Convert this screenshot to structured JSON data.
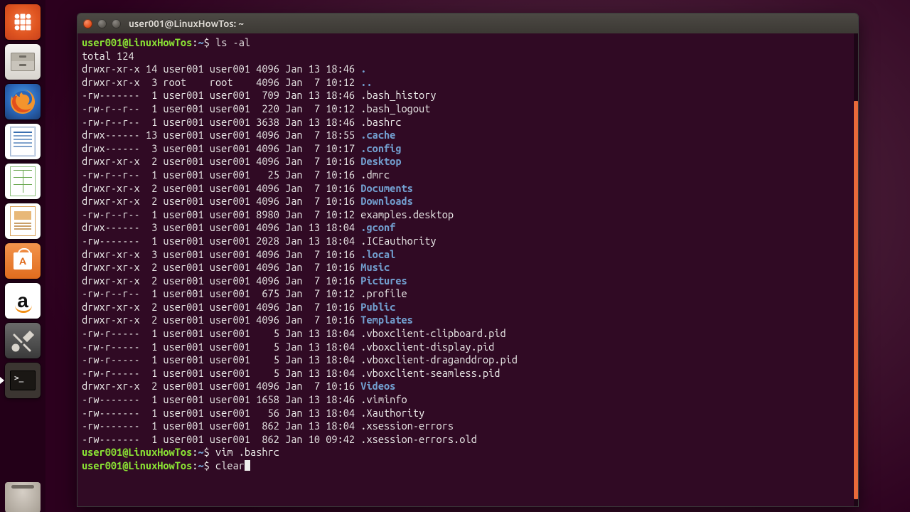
{
  "window": {
    "title": "user001@LinuxHowTos: ~"
  },
  "launcher": {
    "items": [
      "dash",
      "files",
      "firefox",
      "writer",
      "calc",
      "impress",
      "software",
      "amazon",
      "settings",
      "terminal"
    ],
    "amazon_glyph": "a"
  },
  "prompt": {
    "user": "user001",
    "host": "LinuxHowTos",
    "path": "~",
    "symbol": "$"
  },
  "commands": {
    "first": "ls -al",
    "second": "vim .bashrc",
    "third": "clear"
  },
  "total_line": "total 124",
  "listing": [
    {
      "perm": "drwxr-xr-x",
      "n": "14",
      "own": "user001",
      "grp": "user001",
      "size": "4096",
      "date": "Jan 13 18:46",
      "name": ".",
      "dir": true
    },
    {
      "perm": "drwxr-xr-x",
      "n": " 3",
      "own": "root   ",
      "grp": "root   ",
      "size": "4096",
      "date": "Jan  7 10:12",
      "name": "..",
      "dir": true
    },
    {
      "perm": "-rw-------",
      "n": " 1",
      "own": "user001",
      "grp": "user001",
      "size": " 709",
      "date": "Jan 13 18:46",
      "name": ".bash_history",
      "dir": false
    },
    {
      "perm": "-rw-r--r--",
      "n": " 1",
      "own": "user001",
      "grp": "user001",
      "size": " 220",
      "date": "Jan  7 10:12",
      "name": ".bash_logout",
      "dir": false
    },
    {
      "perm": "-rw-r--r--",
      "n": " 1",
      "own": "user001",
      "grp": "user001",
      "size": "3638",
      "date": "Jan 13 18:46",
      "name": ".bashrc",
      "dir": false
    },
    {
      "perm": "drwx------",
      "n": "13",
      "own": "user001",
      "grp": "user001",
      "size": "4096",
      "date": "Jan  7 18:55",
      "name": ".cache",
      "dir": true
    },
    {
      "perm": "drwx------",
      "n": " 3",
      "own": "user001",
      "grp": "user001",
      "size": "4096",
      "date": "Jan  7 10:17",
      "name": ".config",
      "dir": true
    },
    {
      "perm": "drwxr-xr-x",
      "n": " 2",
      "own": "user001",
      "grp": "user001",
      "size": "4096",
      "date": "Jan  7 10:16",
      "name": "Desktop",
      "dir": true
    },
    {
      "perm": "-rw-r--r--",
      "n": " 1",
      "own": "user001",
      "grp": "user001",
      "size": "  25",
      "date": "Jan  7 10:16",
      "name": ".dmrc",
      "dir": false
    },
    {
      "perm": "drwxr-xr-x",
      "n": " 2",
      "own": "user001",
      "grp": "user001",
      "size": "4096",
      "date": "Jan  7 10:16",
      "name": "Documents",
      "dir": true
    },
    {
      "perm": "drwxr-xr-x",
      "n": " 2",
      "own": "user001",
      "grp": "user001",
      "size": "4096",
      "date": "Jan  7 10:16",
      "name": "Downloads",
      "dir": true
    },
    {
      "perm": "-rw-r--r--",
      "n": " 1",
      "own": "user001",
      "grp": "user001",
      "size": "8980",
      "date": "Jan  7 10:12",
      "name": "examples.desktop",
      "dir": false
    },
    {
      "perm": "drwx------",
      "n": " 3",
      "own": "user001",
      "grp": "user001",
      "size": "4096",
      "date": "Jan 13 18:04",
      "name": ".gconf",
      "dir": true
    },
    {
      "perm": "-rw-------",
      "n": " 1",
      "own": "user001",
      "grp": "user001",
      "size": "2028",
      "date": "Jan 13 18:04",
      "name": ".ICEauthority",
      "dir": false
    },
    {
      "perm": "drwxr-xr-x",
      "n": " 3",
      "own": "user001",
      "grp": "user001",
      "size": "4096",
      "date": "Jan  7 10:16",
      "name": ".local",
      "dir": true
    },
    {
      "perm": "drwxr-xr-x",
      "n": " 2",
      "own": "user001",
      "grp": "user001",
      "size": "4096",
      "date": "Jan  7 10:16",
      "name": "Music",
      "dir": true
    },
    {
      "perm": "drwxr-xr-x",
      "n": " 2",
      "own": "user001",
      "grp": "user001",
      "size": "4096",
      "date": "Jan  7 10:16",
      "name": "Pictures",
      "dir": true
    },
    {
      "perm": "-rw-r--r--",
      "n": " 1",
      "own": "user001",
      "grp": "user001",
      "size": " 675",
      "date": "Jan  7 10:12",
      "name": ".profile",
      "dir": false
    },
    {
      "perm": "drwxr-xr-x",
      "n": " 2",
      "own": "user001",
      "grp": "user001",
      "size": "4096",
      "date": "Jan  7 10:16",
      "name": "Public",
      "dir": true
    },
    {
      "perm": "drwxr-xr-x",
      "n": " 2",
      "own": "user001",
      "grp": "user001",
      "size": "4096",
      "date": "Jan  7 10:16",
      "name": "Templates",
      "dir": true
    },
    {
      "perm": "-rw-r-----",
      "n": " 1",
      "own": "user001",
      "grp": "user001",
      "size": "   5",
      "date": "Jan 13 18:04",
      "name": ".vboxclient-clipboard.pid",
      "dir": false
    },
    {
      "perm": "-rw-r-----",
      "n": " 1",
      "own": "user001",
      "grp": "user001",
      "size": "   5",
      "date": "Jan 13 18:04",
      "name": ".vboxclient-display.pid",
      "dir": false
    },
    {
      "perm": "-rw-r-----",
      "n": " 1",
      "own": "user001",
      "grp": "user001",
      "size": "   5",
      "date": "Jan 13 18:04",
      "name": ".vboxclient-draganddrop.pid",
      "dir": false
    },
    {
      "perm": "-rw-r-----",
      "n": " 1",
      "own": "user001",
      "grp": "user001",
      "size": "   5",
      "date": "Jan 13 18:04",
      "name": ".vboxclient-seamless.pid",
      "dir": false
    },
    {
      "perm": "drwxr-xr-x",
      "n": " 2",
      "own": "user001",
      "grp": "user001",
      "size": "4096",
      "date": "Jan  7 10:16",
      "name": "Videos",
      "dir": true
    },
    {
      "perm": "-rw-------",
      "n": " 1",
      "own": "user001",
      "grp": "user001",
      "size": "1658",
      "date": "Jan 13 18:46",
      "name": ".viminfo",
      "dir": false
    },
    {
      "perm": "-rw-------",
      "n": " 1",
      "own": "user001",
      "grp": "user001",
      "size": "  56",
      "date": "Jan 13 18:04",
      "name": ".Xauthority",
      "dir": false
    },
    {
      "perm": "-rw-------",
      "n": " 1",
      "own": "user001",
      "grp": "user001",
      "size": " 862",
      "date": "Jan 13 18:04",
      "name": ".xsession-errors",
      "dir": false
    },
    {
      "perm": "-rw-------",
      "n": " 1",
      "own": "user001",
      "grp": "user001",
      "size": " 862",
      "date": "Jan 10 09:42",
      "name": ".xsession-errors.old",
      "dir": false
    }
  ]
}
